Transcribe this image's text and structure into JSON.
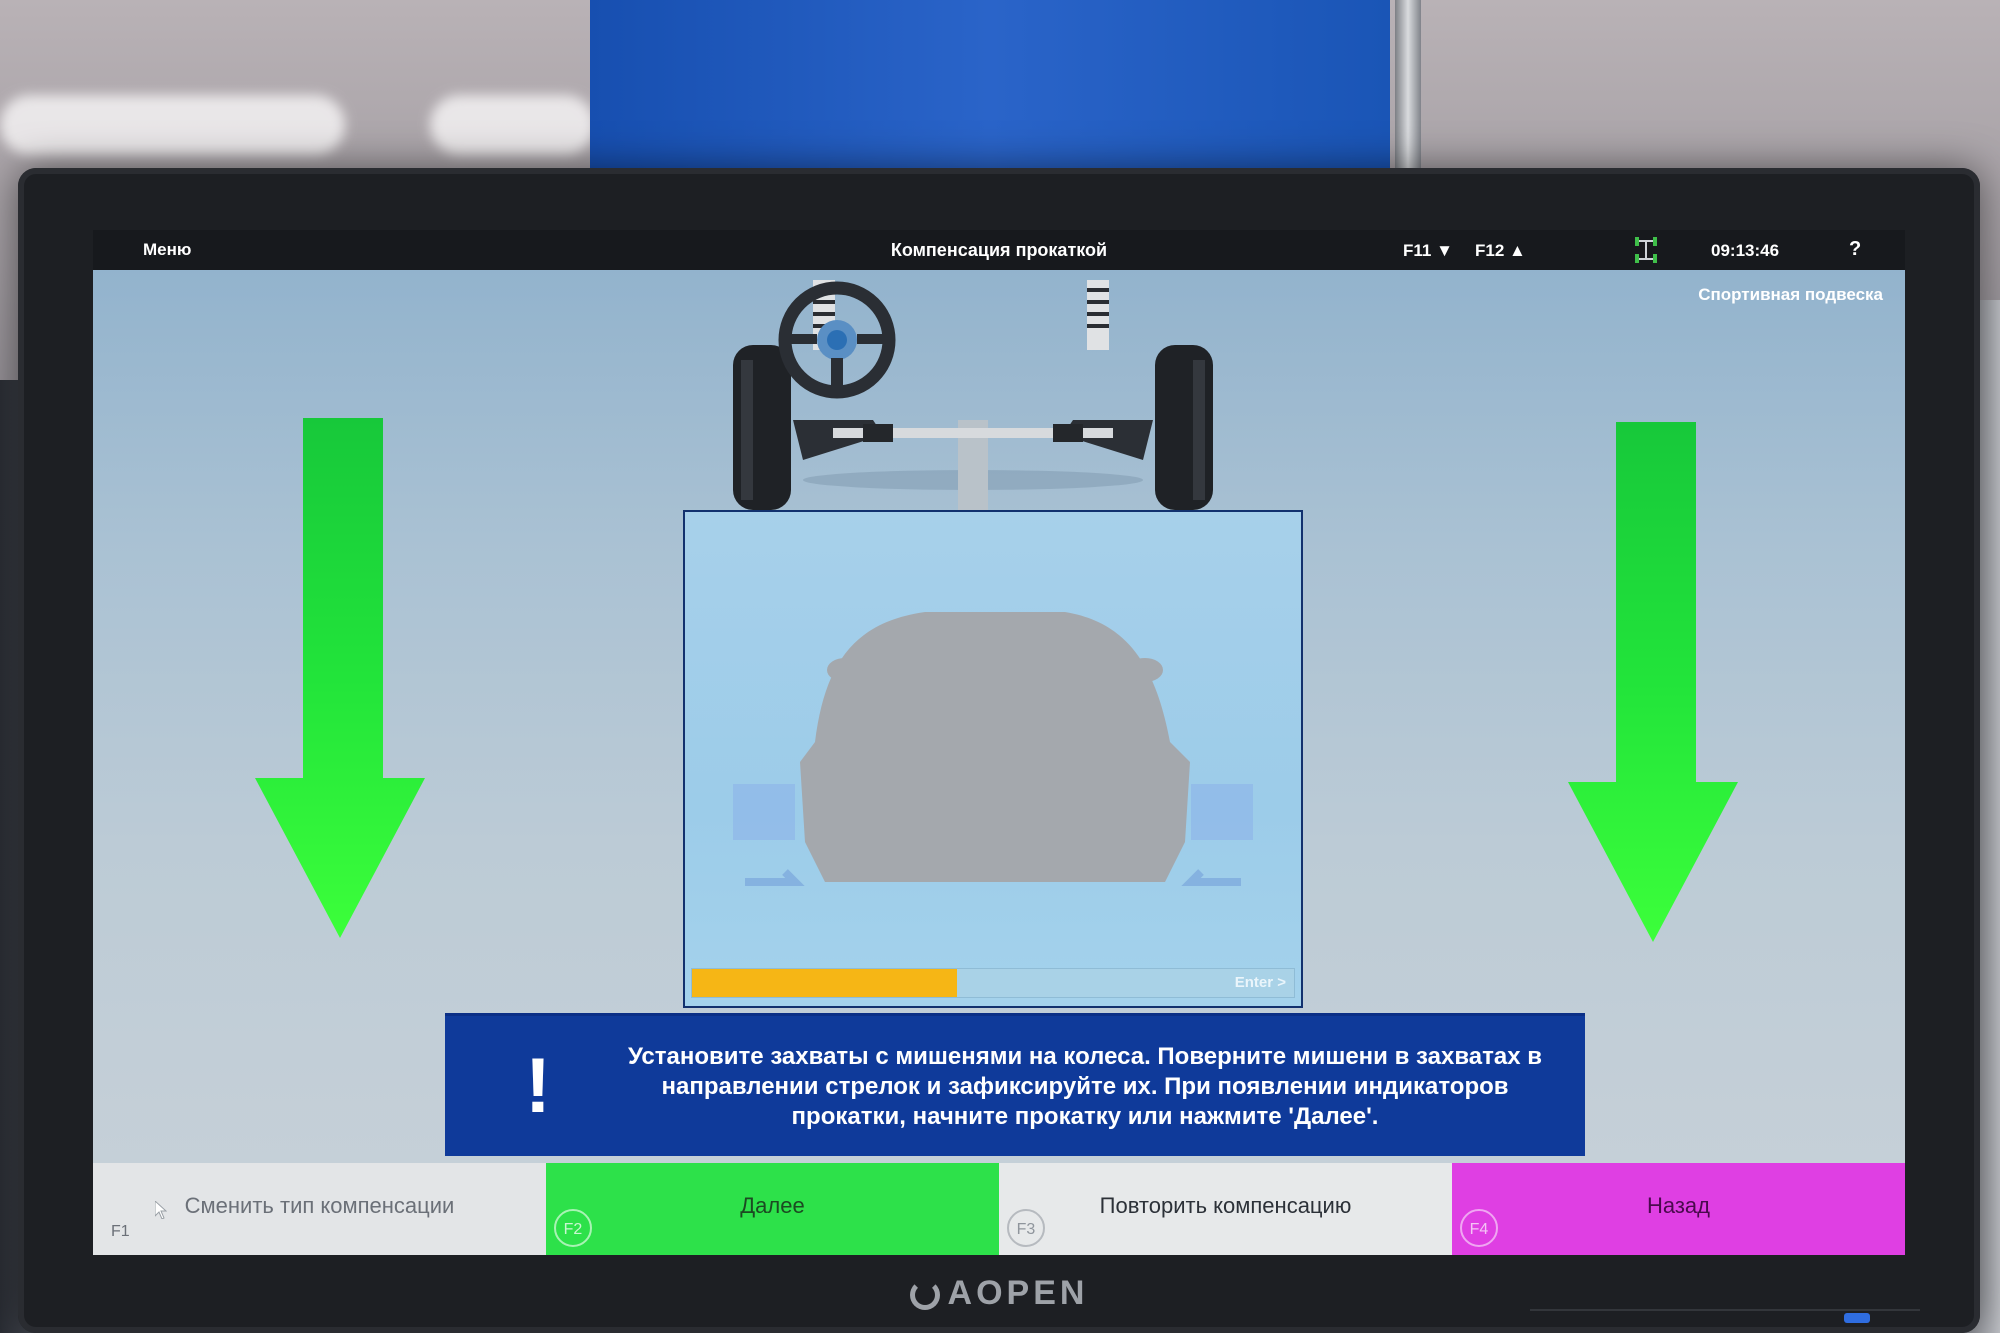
{
  "topbar": {
    "menu_label": "Меню",
    "title": "Компенсация прокаткой",
    "f11_label": "F11 ▼",
    "f12_label": "F12 ▲",
    "clock": "09:13:46",
    "help_label": "?"
  },
  "subtitle": "Спортивная подвеска",
  "progress": {
    "fraction": 0.44,
    "enter_label": "Enter >",
    "fill_color": "#f6b615"
  },
  "message": {
    "icon": "!",
    "text": "Установите захваты с мишенями на колеса. Поверните мишени в захватах в направлении стрелок и зафиксируйте их. При появлении индикаторов прокатки, начните прокатку или нажмите 'Далее'."
  },
  "fkeys": [
    {
      "key": "F1",
      "label": "Сменить тип компенсации",
      "color": "#e3e5e7"
    },
    {
      "key": "F2",
      "label": "Далее",
      "color": "#2de14a"
    },
    {
      "key": "F3",
      "label": "Повторить компенсацию",
      "color": "#e7e9ea"
    },
    {
      "key": "F4",
      "label": "Назад",
      "color": "#df3fe3"
    }
  ],
  "monitor_brand": "AOPEN",
  "arrow_color": "#22e43a",
  "icons": [
    "arrow-down-icon",
    "wheel-alignment-status-icon",
    "steering-wheel-icon",
    "car-silhouette-icon",
    "mouse-cursor-icon",
    "aopen-logo-icon"
  ]
}
